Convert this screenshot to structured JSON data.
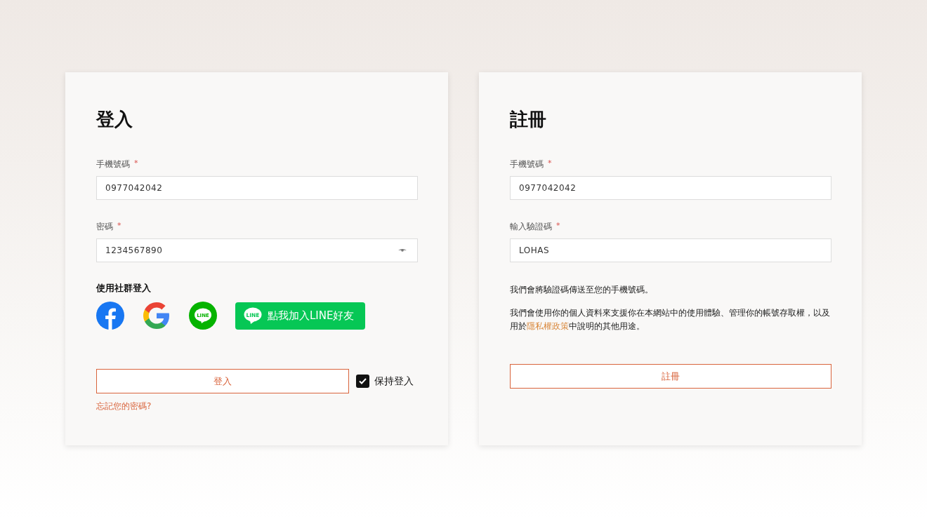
{
  "login": {
    "title": "登入",
    "fields": [
      {
        "label": "手機號碼",
        "required_mark": "*",
        "value": "0977042042",
        "kind": "text"
      },
      {
        "label": "密碼",
        "required_mark": "*",
        "value": "1234567890",
        "kind": "password"
      }
    ],
    "social": {
      "heading": "使用社群登入",
      "icons": [
        {
          "kind": "facebook"
        },
        {
          "kind": "google"
        },
        {
          "kind": "line",
          "logo_text": "LINE"
        }
      ],
      "line_button": {
        "logo_text": "LINE",
        "label": "點我加入LINE好友"
      }
    },
    "submit": "登入",
    "keep_signed_in": {
      "label": "保持登入",
      "checked": true
    },
    "forgot": "忘記您的密碼?"
  },
  "register": {
    "title": "註冊",
    "fields": [
      {
        "label": "手機號碼",
        "required_mark": "*",
        "value": "0977042042",
        "kind": "text"
      },
      {
        "label": "輸入驗證碼",
        "required_mark": "*",
        "value": "LOHAS",
        "kind": "text"
      }
    ],
    "notice": "我們會將驗證碼傳送至您的手機號碼。",
    "privacy": {
      "before": "我們會使用你的個人資料來支援你在本網站中的使用體驗、管理你的帳號存取權，以及用於",
      "link": "隱私權政策",
      "after": "中說明的其他用途。"
    },
    "submit": "註冊"
  }
}
